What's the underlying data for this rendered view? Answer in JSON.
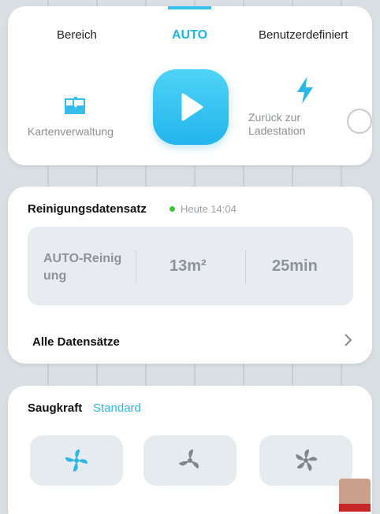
{
  "tabs": {
    "bereich": "Bereich",
    "auto": "AUTO",
    "custom": "Benutzerdefiniert"
  },
  "actions": {
    "map_label": "Kartenverwaltung",
    "dock_label_line1": "Zurück zur",
    "dock_label_line2": "Ladestation"
  },
  "record": {
    "title": "Reinigungsdatensatz",
    "time": "Heute 14:04",
    "mode_line1": "AUTO-Reinig",
    "mode_line2": "ung",
    "area": "13m²",
    "duration": "25min",
    "all_label": "Alle Datensätze"
  },
  "suction": {
    "title": "Saugkraft",
    "value": "Standard"
  },
  "colors": {
    "accent": "#2db7e2",
    "status_dot": "#3cc43c"
  },
  "icons": [
    "map-icon",
    "play-icon",
    "bolt-icon",
    "chevron-right-icon",
    "fan-icon"
  ]
}
